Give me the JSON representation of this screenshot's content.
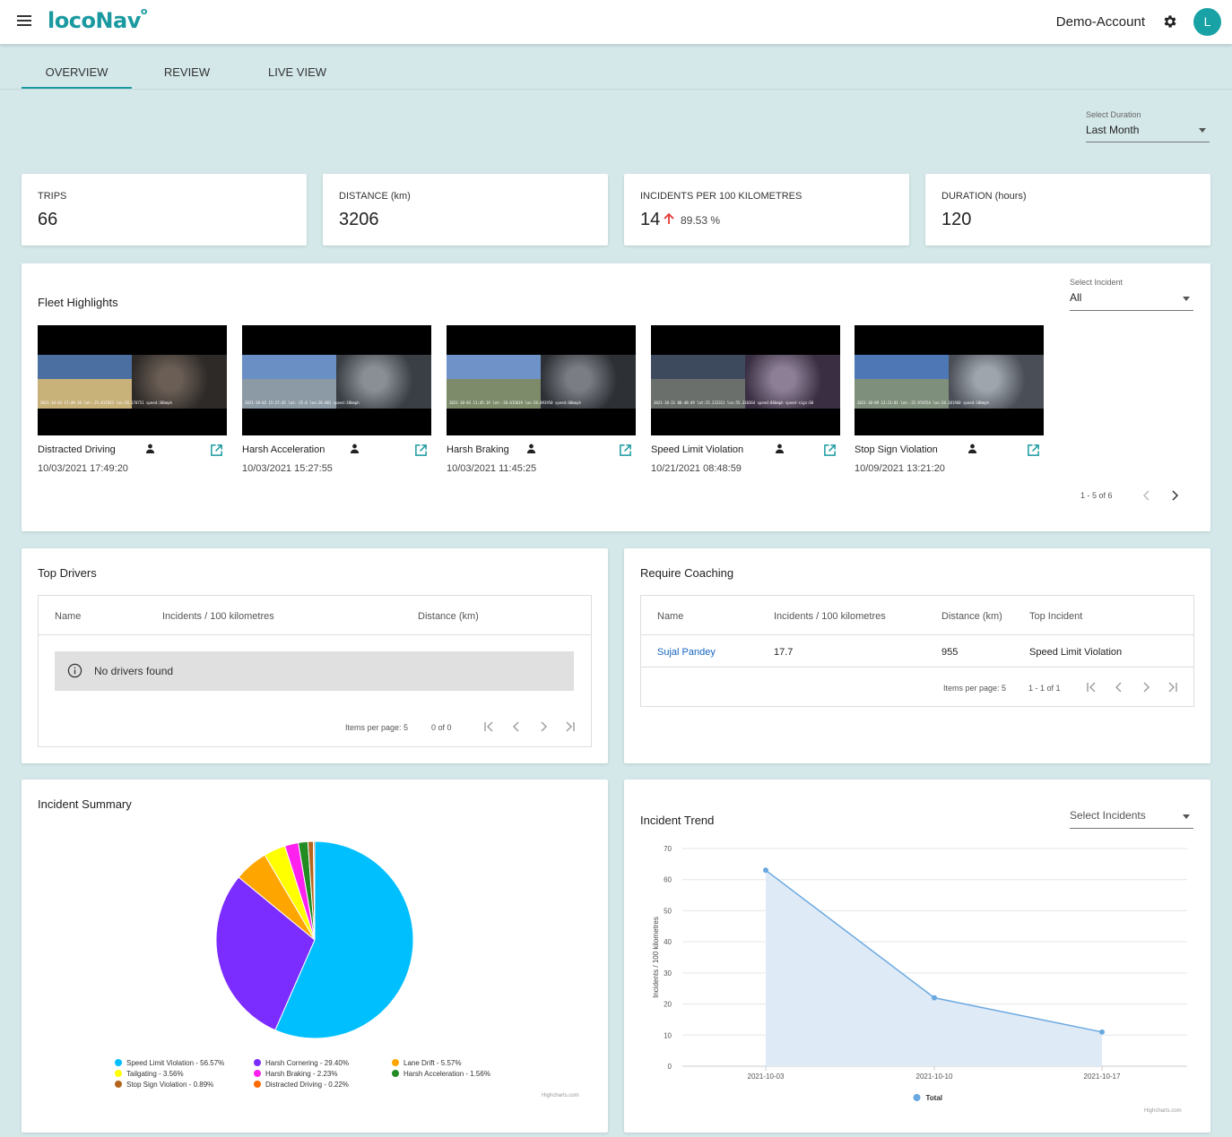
{
  "header": {
    "logo": "locoNav",
    "account_name": "Demo-Account",
    "avatar_initial": "L"
  },
  "tabs": [
    {
      "label": "OVERVIEW",
      "active": true
    },
    {
      "label": "REVIEW",
      "active": false
    },
    {
      "label": "LIVE VIEW",
      "active": false
    }
  ],
  "duration": {
    "label": "Select Duration",
    "value": "Last Month"
  },
  "stats": [
    {
      "label": "TRIPS",
      "value": "66"
    },
    {
      "label": "DISTANCE (km)",
      "value": "3206"
    },
    {
      "label": "INCIDENTS PER 100 KILOMETRES",
      "value": "14",
      "change": "89.53 %"
    },
    {
      "label": "DURATION (hours)",
      "value": "120"
    }
  ],
  "fleet_highlights": {
    "title": "Fleet Highlights",
    "incident_select": {
      "label": "Select Incident",
      "value": "All"
    },
    "items": [
      {
        "name": "Distracted Driving",
        "time": "10/03/2021 17:49:20",
        "stamp": "2021-10-03 17:49:10 lat:-25.017653 lon:28.170751 speed:36kmph"
      },
      {
        "name": "Harsh Acceleration",
        "time": "10/03/2021 15:27:55",
        "stamp": "2021-10-03 15:27:45 lat:-25.0 lon:28.081 speed:38kmph"
      },
      {
        "name": "Harsh Braking",
        "time": "10/03/2021 11:45:25",
        "stamp": "2021-10-03 11:45:19 lat:-28.015019 lon:28.093950 speed:60kmph"
      },
      {
        "name": "Speed Limit Violation",
        "time": "10/21/2021 08:48:59",
        "stamp": "2021-10-21 08:48:49 lat:25.232311 lon:55.310364 speed:86kmph speed-sign:60"
      },
      {
        "name": "Stop Sign Violation",
        "time": "10/09/2021 13:21:20",
        "stamp": "2021-10-09 13:21:01 lat:-25.974554 lon:28.181960 speed:18kmph"
      }
    ],
    "pager": "1 - 5 of 6"
  },
  "top_drivers": {
    "title": "Top Drivers",
    "columns": [
      "Name",
      "Incidents / 100 kilometres",
      "Distance (km)"
    ],
    "empty_message": "No drivers found",
    "items_per_page": "Items per page: 5",
    "range": "0 of 0"
  },
  "require_coaching": {
    "title": "Require Coaching",
    "columns": [
      "Name",
      "Incidents / 100 kilometres",
      "Distance (km)",
      "Top Incident"
    ],
    "rows": [
      {
        "name": "Sujal Pandey",
        "incidents": "17.7",
        "distance": "955",
        "top_incident": "Speed Limit Violation"
      }
    ],
    "items_per_page": "Items per page: 5",
    "range": "1 - 1 of 1"
  },
  "incident_summary": {
    "title": "Incident Summary",
    "credit": "Highcharts.com",
    "legend": [
      "Speed Limit Violation - 56.57%",
      "Harsh Cornering - 29.40%",
      "Lane Drift - 5.57%",
      "Tailgating - 3.56%",
      "Harsh Braking - 2.23%",
      "Harsh Acceleration - 1.56%",
      "Stop Sign Violation - 0.89%",
      "Distracted Driving - 0.22%"
    ]
  },
  "incident_trend": {
    "title": "Incident Trend",
    "select_placeholder": "Select Incidents",
    "credit": "Highcharts.com"
  },
  "chart_data": [
    {
      "type": "pie",
      "title": "Incident Summary",
      "categories": [
        "Speed Limit Violation",
        "Harsh Cornering",
        "Lane Drift",
        "Tailgating",
        "Harsh Braking",
        "Harsh Acceleration",
        "Stop Sign Violation",
        "Distracted Driving"
      ],
      "values": [
        56.57,
        29.4,
        5.57,
        3.56,
        2.23,
        1.56,
        0.89,
        0.22
      ],
      "colors": [
        "#00bfff",
        "#7b2cff",
        "#ffa500",
        "#ffff00",
        "#ff22ee",
        "#228b22",
        "#b5651d",
        "#ff6a00"
      ],
      "legend_position": "bottom"
    },
    {
      "type": "area",
      "title": "Incident Trend",
      "x": [
        "2021-10-03",
        "2021-10-10",
        "2021-10-17"
      ],
      "series": [
        {
          "name": "Total",
          "values": [
            63,
            22,
            11
          ]
        }
      ],
      "ylabel": "Incidents / 100 kilometres",
      "ylim": [
        0,
        70
      ],
      "yticks": [
        0,
        10,
        20,
        30,
        40,
        50,
        60,
        70
      ],
      "grid": true,
      "legend_position": "bottom",
      "line_color": "#6aa9e0",
      "fill_color": "#dfeaf7"
    }
  ]
}
